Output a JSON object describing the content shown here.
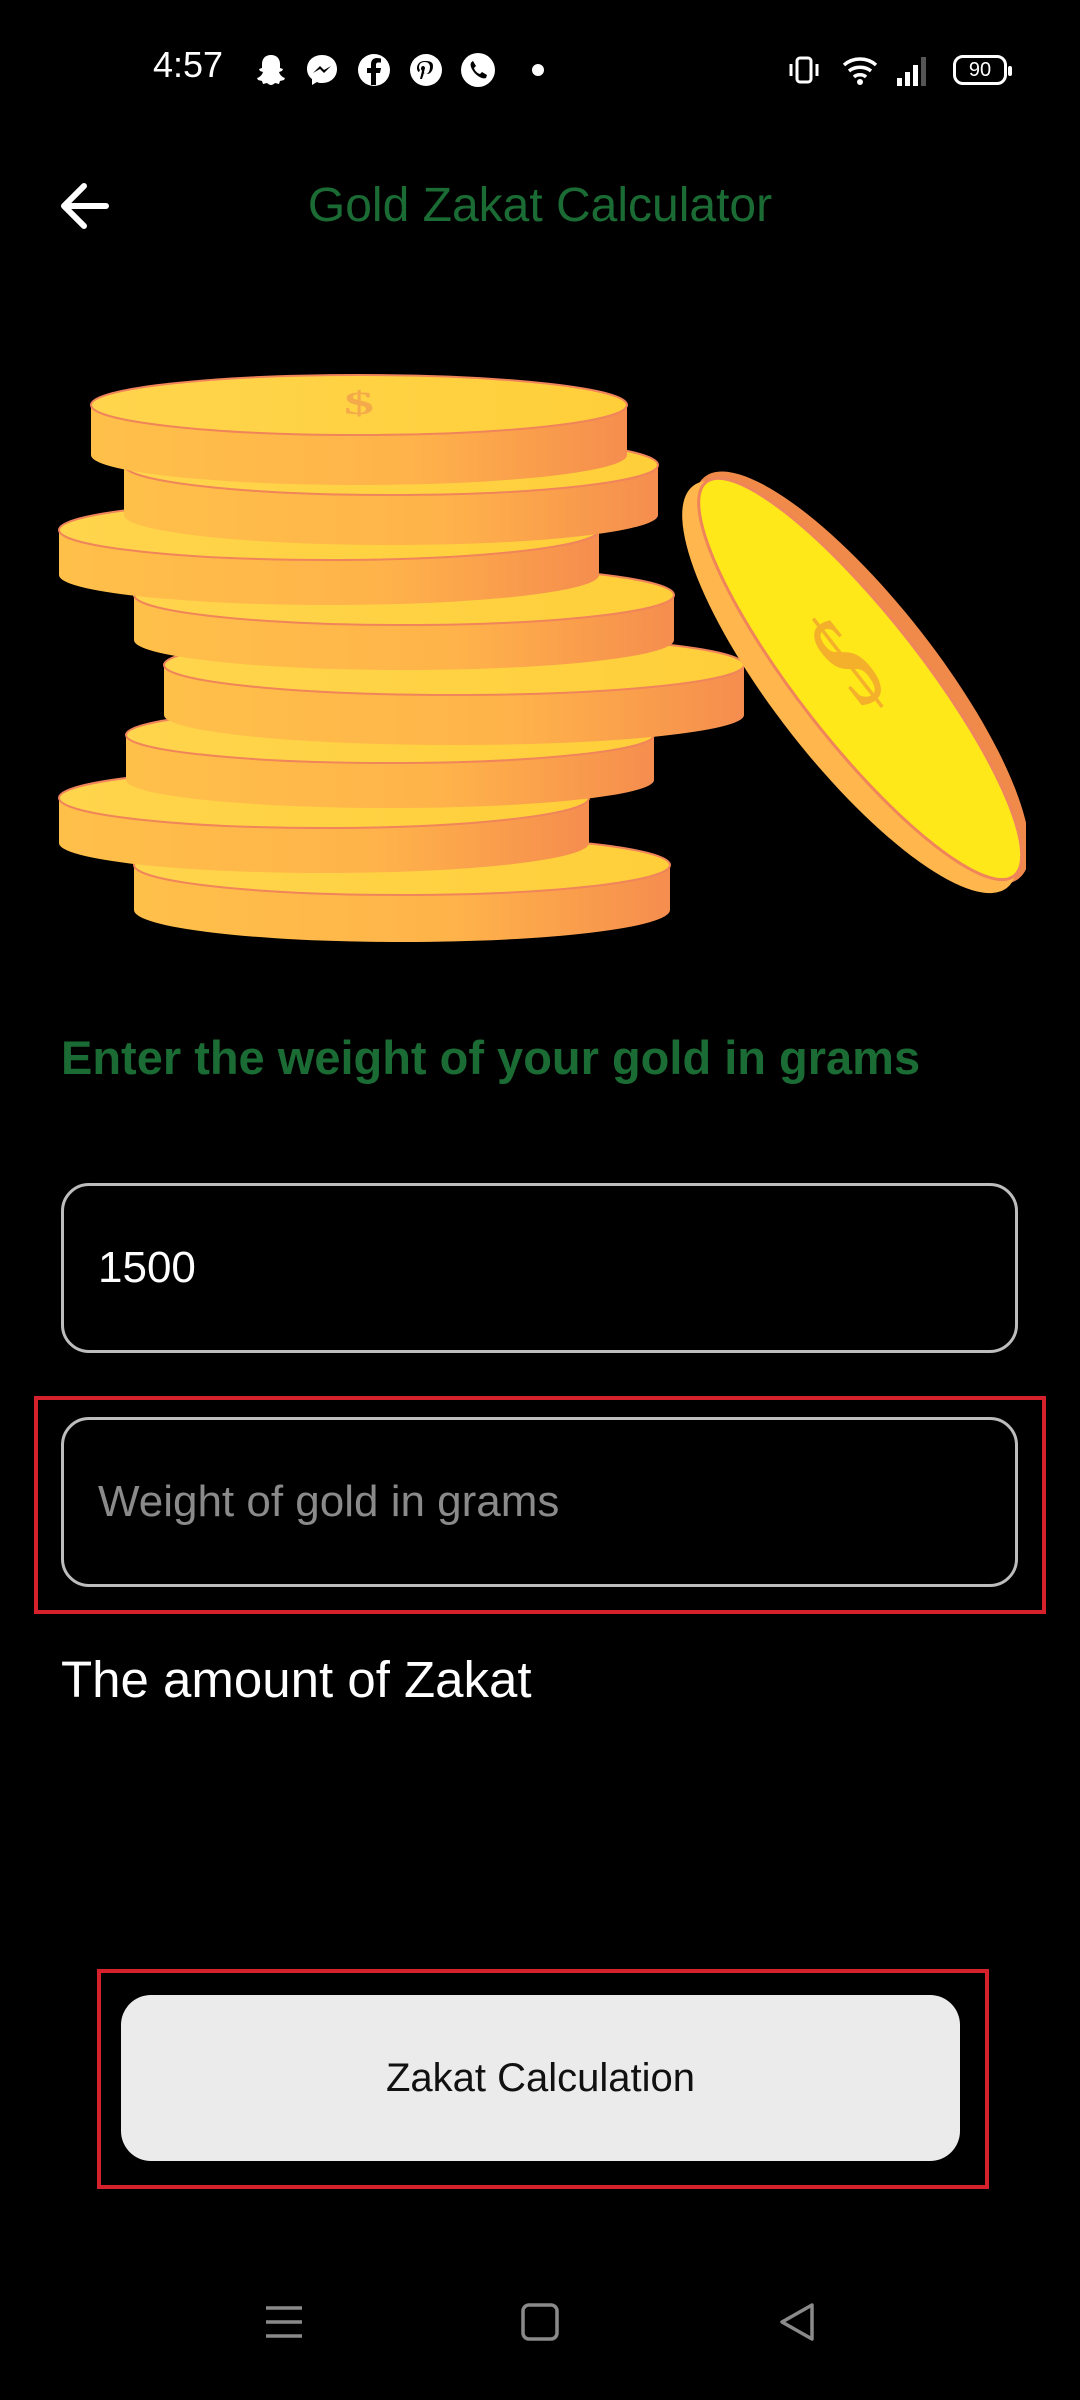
{
  "status_bar": {
    "time": "4:57",
    "battery": "90",
    "icons": [
      "snapchat-icon",
      "messenger-icon",
      "facebook-icon",
      "pinterest-icon",
      "phone-icon",
      "dot-icon",
      "vibrate-icon",
      "wifi-icon",
      "signal-icon",
      "battery-icon"
    ]
  },
  "header": {
    "title": "Gold Zakat Calculator",
    "back_icon": "arrow-left-icon"
  },
  "illustration": "gold-coins-image",
  "form": {
    "prompt": "Enter the weight of your gold in grams",
    "weight_input_value": "1500",
    "second_input_placeholder": "Weight of gold in grams",
    "amount_label": "The amount of Zakat",
    "calculate_button_label": "Zakat Calculation"
  },
  "nav_bar": {
    "icons": [
      "menu-icon",
      "home-square-icon",
      "back-triangle-icon"
    ]
  },
  "colors": {
    "title_green": "#1b6b34",
    "highlight_red": "#d4212b",
    "button_bg": "#ebebeb",
    "gold": "#ffb84d"
  }
}
